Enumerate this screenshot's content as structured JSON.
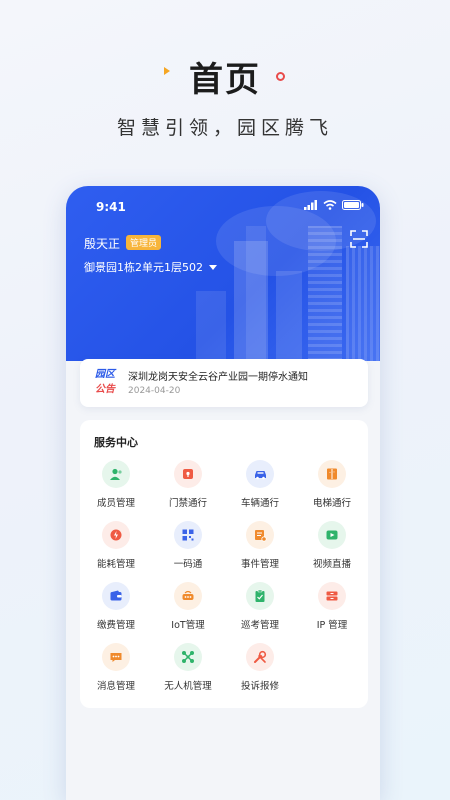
{
  "promo": {
    "title": "首页",
    "subtitle": "智慧引领，园区腾飞"
  },
  "status_bar": {
    "time": "9:41"
  },
  "header": {
    "user_name": "殷天正",
    "role": "管理员",
    "address": "御景园1栋2单元1层502"
  },
  "notice": {
    "logo_line1": "园区",
    "logo_line2": "公告",
    "title": "深圳龙岗天安全云谷产业园一期停水通知",
    "date": "2024-04-20"
  },
  "services": {
    "title": "服务中心",
    "items": [
      {
        "label": "成员管理",
        "icon": "members-icon",
        "color": "#2fb36b",
        "bg": "#e6f6ec"
      },
      {
        "label": "门禁通行",
        "icon": "access-control-icon",
        "color": "#ef5a43",
        "bg": "#fdece8"
      },
      {
        "label": "车辆通行",
        "icon": "car-icon",
        "color": "#3a63e8",
        "bg": "#e8eefc"
      },
      {
        "label": "电梯通行",
        "icon": "elevator-icon",
        "color": "#f08a2c",
        "bg": "#fdf0e3"
      },
      {
        "label": "能耗管理",
        "icon": "energy-icon",
        "color": "#ef5a43",
        "bg": "#fdece8"
      },
      {
        "label": "一码通",
        "icon": "qrcode-icon",
        "color": "#3a63e8",
        "bg": "#e8eefc"
      },
      {
        "label": "事件管理",
        "icon": "event-icon",
        "color": "#f08a2c",
        "bg": "#fdf0e3"
      },
      {
        "label": "视频直播",
        "icon": "video-icon",
        "color": "#2fb36b",
        "bg": "#e6f6ec"
      },
      {
        "label": "缴费管理",
        "icon": "wallet-icon",
        "color": "#3a63e8",
        "bg": "#e8eefc"
      },
      {
        "label": "IoT管理",
        "icon": "iot-icon",
        "color": "#f08a2c",
        "bg": "#fdf0e3"
      },
      {
        "label": "巡考管理",
        "icon": "inspection-icon",
        "color": "#2fb36b",
        "bg": "#e6f6ec"
      },
      {
        "label": "IP 管理",
        "icon": "ip-icon",
        "color": "#ef5a43",
        "bg": "#fdece8"
      },
      {
        "label": "消息管理",
        "icon": "message-icon",
        "color": "#f08a2c",
        "bg": "#fdf0e3"
      },
      {
        "label": "无人机管理",
        "icon": "drone-icon",
        "color": "#2fb36b",
        "bg": "#e6f6ec"
      },
      {
        "label": "投诉报修",
        "icon": "repair-icon",
        "color": "#ef5a43",
        "bg": "#fdece8"
      }
    ]
  }
}
